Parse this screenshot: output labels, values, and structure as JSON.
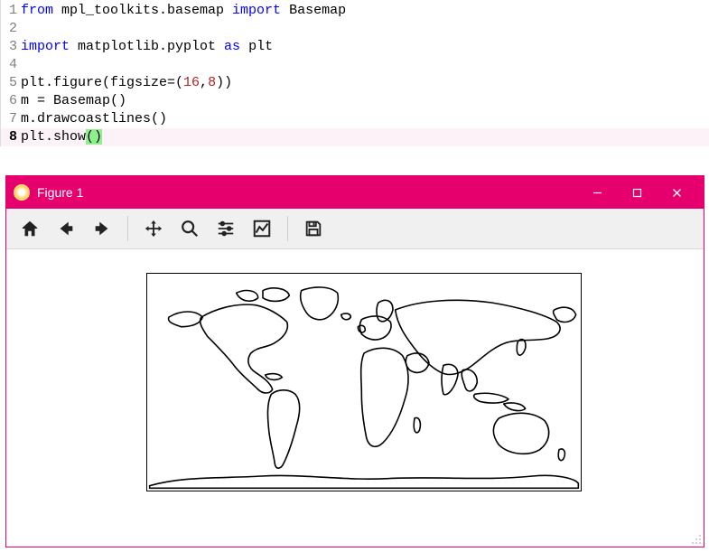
{
  "code": {
    "lines": [
      {
        "n": "1",
        "tokens": [
          {
            "t": "from ",
            "c": "kw"
          },
          {
            "t": "mpl_toolkits.basemap "
          },
          {
            "t": "import ",
            "c": "kw"
          },
          {
            "t": "Basemap"
          }
        ]
      },
      {
        "n": "2",
        "tokens": []
      },
      {
        "n": "3",
        "tokens": [
          {
            "t": "import ",
            "c": "kw"
          },
          {
            "t": "matplotlib.pyplot "
          },
          {
            "t": "as ",
            "c": "kw"
          },
          {
            "t": "plt"
          }
        ]
      },
      {
        "n": "4",
        "tokens": []
      },
      {
        "n": "5",
        "tokens": [
          {
            "t": "plt.figure(figsize=("
          },
          {
            "t": "16",
            "c": "num"
          },
          {
            "t": ","
          },
          {
            "t": "8",
            "c": "num"
          },
          {
            "t": "))"
          }
        ]
      },
      {
        "n": "6",
        "tokens": [
          {
            "t": "m = Basemap()"
          }
        ]
      },
      {
        "n": "7",
        "tokens": [
          {
            "t": "m.drawcoastlines()"
          }
        ]
      },
      {
        "n": "8",
        "bold": true,
        "current": true,
        "tokens": [
          {
            "t": "plt.show"
          },
          {
            "t": "(",
            "c": "cursor-paren"
          },
          {
            "t": ")",
            "c": "cursor-paren"
          }
        ]
      }
    ]
  },
  "figure_window": {
    "title": "Figure 1",
    "controls": {
      "minimize_label": "Minimize",
      "maximize_label": "Maximize",
      "close_label": "Close"
    },
    "toolbar": {
      "home": "Home",
      "back": "Back",
      "forward": "Forward",
      "pan": "Pan",
      "zoom": "Zoom",
      "subplots": "Configure subplots",
      "edit": "Edit parameters",
      "save": "Save"
    }
  },
  "chart_data": {
    "type": "map",
    "projection": "cylindrical (Basemap default)",
    "content": "world coastlines",
    "xlim": [
      -180,
      180
    ],
    "ylim": [
      -90,
      90
    ],
    "line_color": "#000000",
    "fill": "none"
  }
}
